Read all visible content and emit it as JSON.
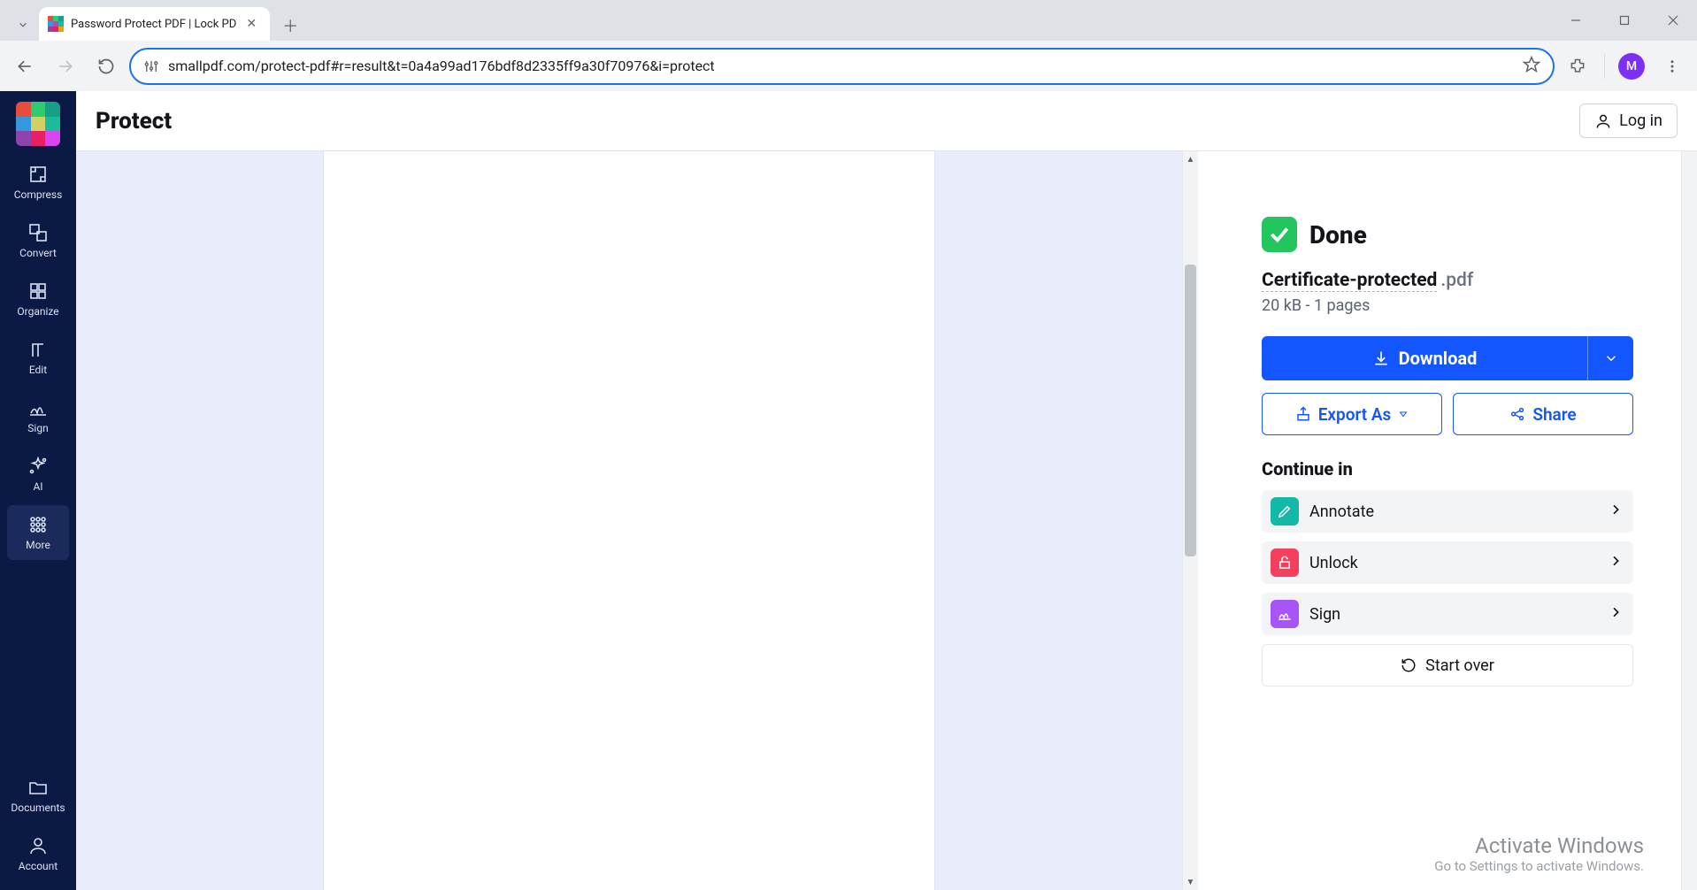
{
  "browser": {
    "tab_title": "Password Protect PDF | Lock PD",
    "url": "smallpdf.com/protect-pdf#r=result&t=0a4a99ad176bdf8d2335ff9a30f70976&i=protect",
    "avatar_initial": "M"
  },
  "sidebar": {
    "items": [
      {
        "label": "Compress"
      },
      {
        "label": "Convert"
      },
      {
        "label": "Organize"
      },
      {
        "label": "Edit"
      },
      {
        "label": "Sign"
      },
      {
        "label": "AI"
      },
      {
        "label": "More"
      },
      {
        "label": "Documents"
      },
      {
        "label": "Account"
      }
    ]
  },
  "header": {
    "page_title": "Protect",
    "login_label": "Log in"
  },
  "result": {
    "done_label": "Done",
    "filename_base": "Certificate-protected",
    "filename_ext": ".pdf",
    "meta": "20 kB - 1 pages",
    "download_label": "Download",
    "export_label": "Export As",
    "share_label": "Share",
    "continue_heading": "Continue in",
    "continue_items": [
      {
        "label": "Annotate"
      },
      {
        "label": "Unlock"
      },
      {
        "label": "Sign"
      }
    ],
    "start_over_label": "Start over"
  },
  "watermark": {
    "line1": "Activate Windows",
    "line2": "Go to Settings to activate Windows."
  }
}
